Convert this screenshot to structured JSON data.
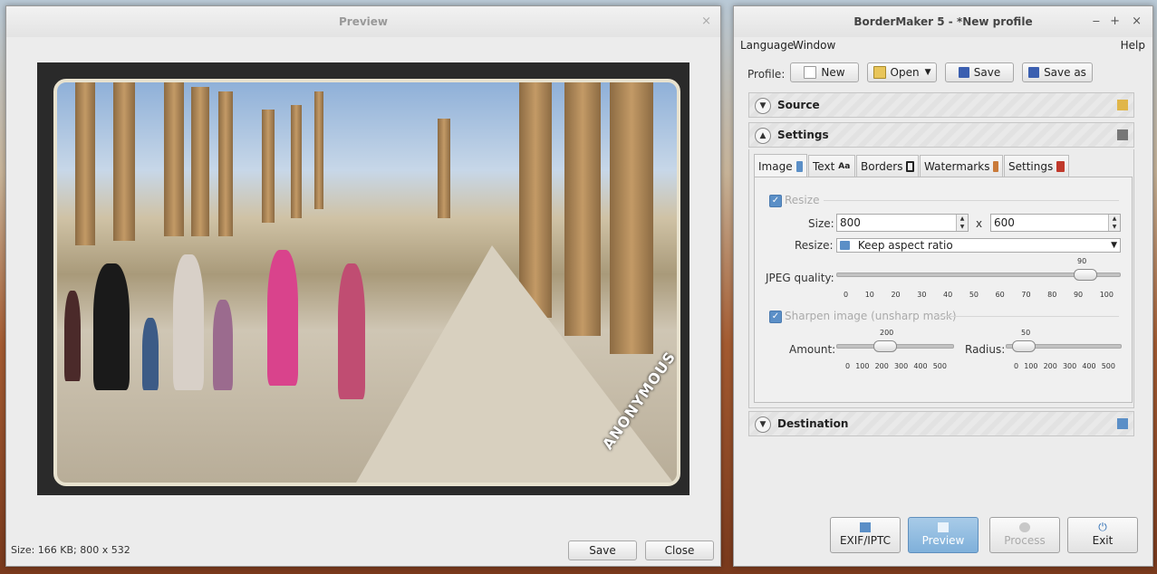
{
  "preview": {
    "title": "Preview",
    "close_glyph": "×",
    "status": "Size: 166 KB; 800 x 532",
    "save_label": "Save",
    "close_label": "Close",
    "watermark_text": "ANONYMOUS"
  },
  "bm": {
    "title": "BorderMaker 5 - *New profile",
    "window_controls": [
      "‒",
      "+",
      "×"
    ],
    "menu": {
      "language": "Language",
      "window": "Window",
      "help": "Help"
    },
    "profile_label": "Profile:",
    "profile_buttons": {
      "new": "New",
      "open": "Open",
      "save": "Save",
      "save_as": "Save as"
    },
    "sections": {
      "source": "Source",
      "settings": "Settings",
      "destination": "Destination"
    },
    "tabs": [
      "Image",
      "Text",
      "Borders",
      "Watermarks",
      "Settings"
    ],
    "image_tab": {
      "resize_checkbox": "Resize",
      "size_label": "Size:",
      "width": "800",
      "x_sep": "x",
      "height": "600",
      "resize_label": "Resize:",
      "resize_mode": "Keep aspect ratio",
      "jpeg_label": "JPEG quality:",
      "jpeg_value": 90,
      "jpeg_ticks": [
        "0",
        "10",
        "20",
        "30",
        "40",
        "50",
        "60",
        "70",
        "80",
        "90",
        "100"
      ],
      "sharpen_checkbox": "Sharpen image (unsharp mask)",
      "amount_label": "Amount:",
      "amount_value": 200,
      "radius_label": "Radius:",
      "radius_value": 50,
      "small_ticks": [
        "0",
        "100",
        "200",
        "300",
        "400",
        "500"
      ]
    },
    "bottom_buttons": {
      "exif": "EXIF/IPTC",
      "preview": "Preview",
      "process": "Process",
      "exit": "Exit"
    }
  },
  "colors": {
    "accent": "#7fb0da",
    "check": "#5b8fc7",
    "tab_icon_red": "#c0392b"
  }
}
